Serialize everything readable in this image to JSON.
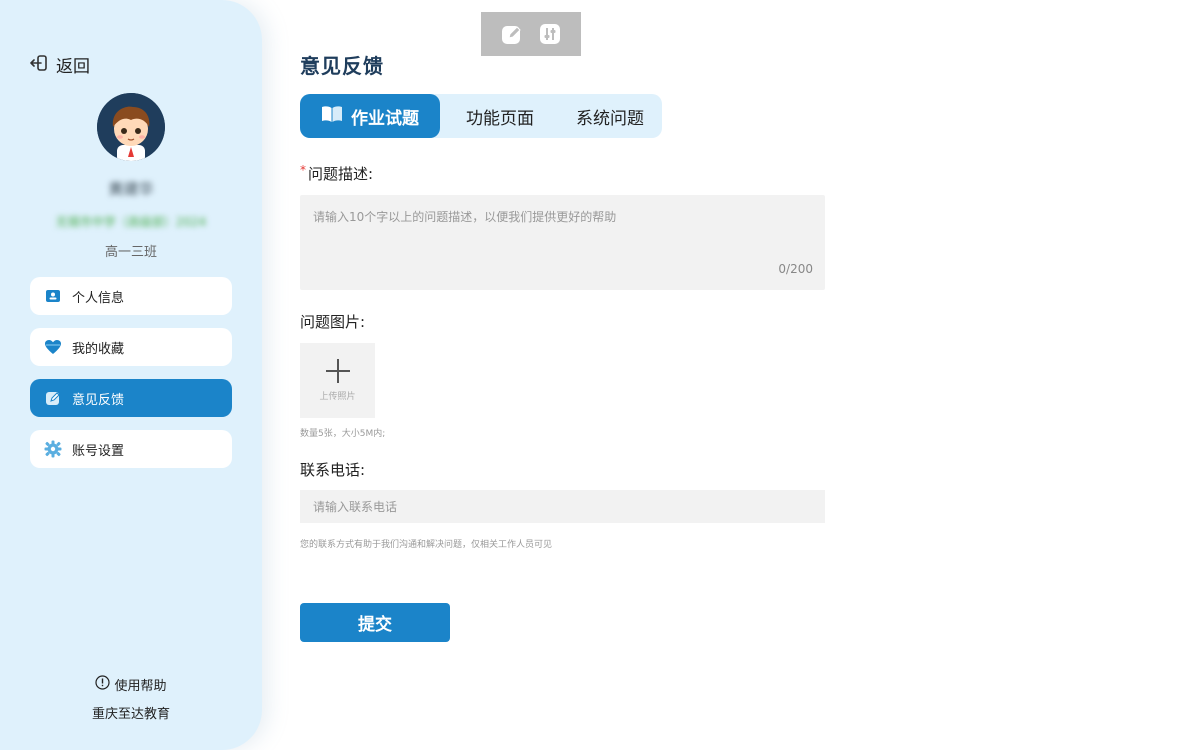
{
  "sidebar": {
    "back_label": "返回",
    "user": {
      "name": "黄建华",
      "school": "无锡市中学（高级部）2024",
      "class": "高一三班"
    },
    "menu": [
      {
        "label": "个人信息",
        "icon": "id-card-icon"
      },
      {
        "label": "我的收藏",
        "icon": "heart-icon"
      },
      {
        "label": "意见反馈",
        "icon": "edit-icon",
        "active": true
      },
      {
        "label": "账号设置",
        "icon": "gear-icon"
      }
    ],
    "help_label": "使用帮助",
    "brand": "重庆至达教育"
  },
  "toolbar": {
    "icons": [
      "edit-icon",
      "sliders-icon"
    ]
  },
  "main": {
    "title": "意见反馈",
    "tabs": [
      {
        "label": "作业试题",
        "active": true
      },
      {
        "label": "功能页面"
      },
      {
        "label": "系统问题"
      }
    ],
    "description": {
      "required_mark": "*",
      "label": "问题描述:",
      "placeholder": "请输入10个字以上的问题描述，以便我们提供更好的帮助",
      "counter": "0/200"
    },
    "images": {
      "label": "问题图片:",
      "upload_label": "上传照片",
      "hint": "数量5张，大小5M内;"
    },
    "phone": {
      "label": "联系电话:",
      "placeholder": "请输入联系电话",
      "hint": "您的联系方式有助于我们沟通和解决问题，仅相关工作人员可见"
    },
    "submit_label": "提交"
  },
  "colors": {
    "primary": "#1b84c9",
    "sidebar_bg": "#dff1fc",
    "title": "#1f3d5c",
    "required": "#e53935"
  }
}
